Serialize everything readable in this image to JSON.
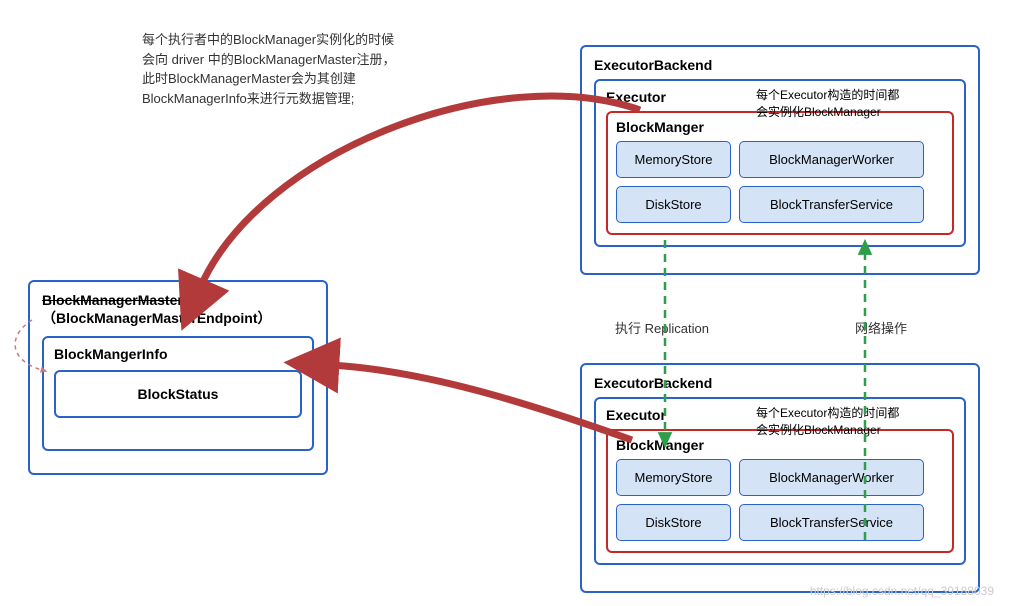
{
  "note_top": {
    "l1": "每个执行者中的BlockManager实例化的时候",
    "l2": "会向 driver 中的BlockManagerMaster注册，",
    "l3": "此时BlockManagerMaster会为其创建",
    "l4": "BlockManagerInfo来进行元数据管理;"
  },
  "master": {
    "title_strike": "BlockManagerMaster",
    "title": "（BlockManagerMasterEndpoint）",
    "info_title": "BlockMangerInfo",
    "status_title": "BlockStatus"
  },
  "backend_title": "ExecutorBackend",
  "executor_title": "Executor",
  "exec_note": {
    "l1": "每个Executor构造的时间都",
    "l2": "会实例化BlockManager"
  },
  "block_manager": {
    "title": "BlockManger",
    "memory": "MemoryStore",
    "disk": "DiskStore",
    "worker": "BlockManagerWorker",
    "transfer": "BlockTransferService"
  },
  "mid": {
    "replication": "执行 Replication",
    "network": "网络操作"
  },
  "watermark": "https://blog.csdn.net/qq_39188039"
}
